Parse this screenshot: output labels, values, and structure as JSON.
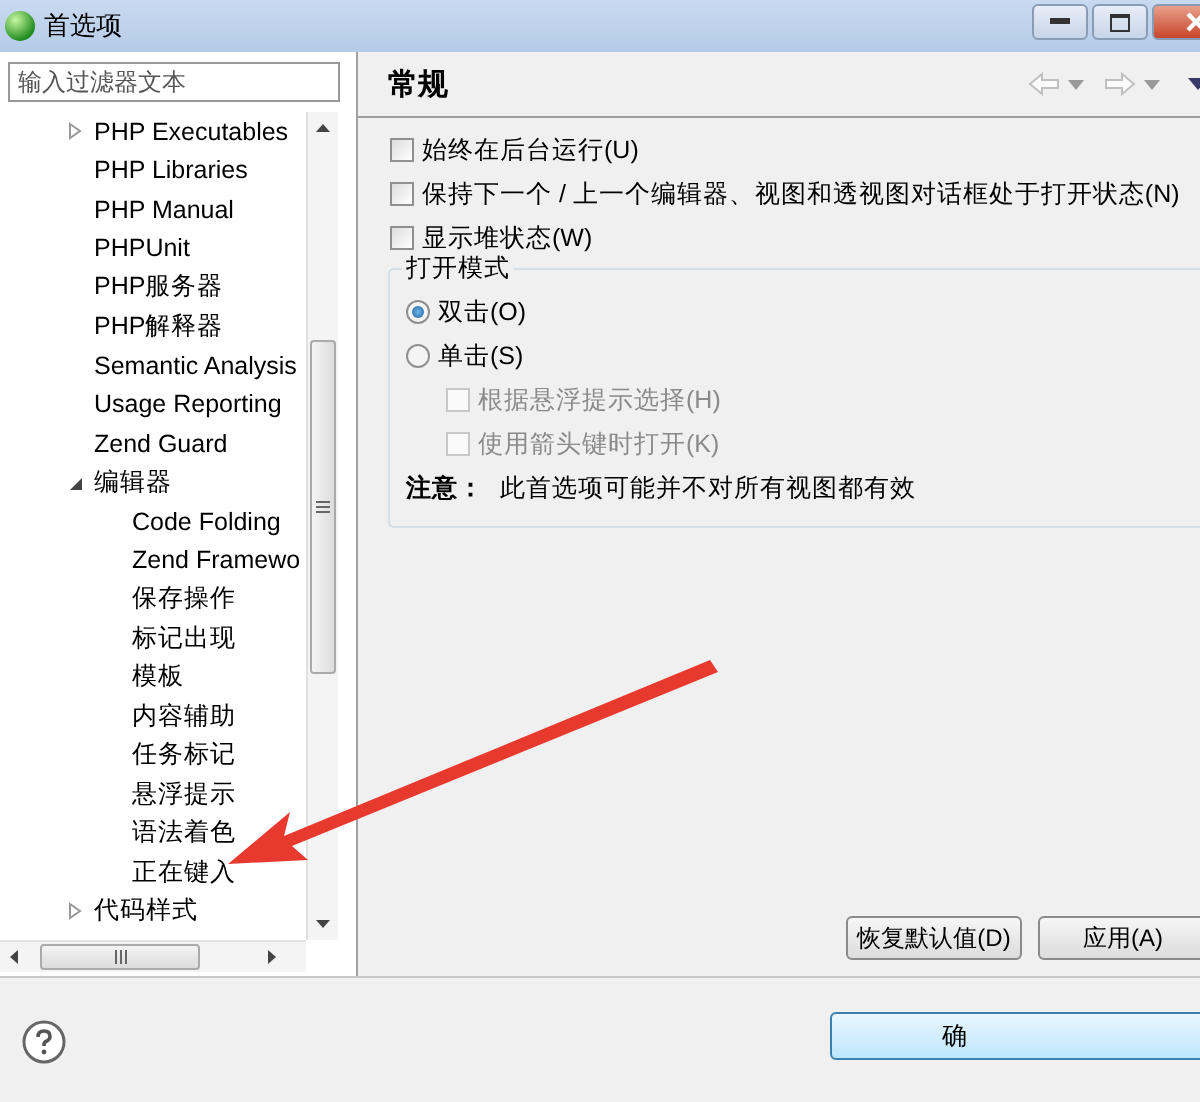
{
  "window": {
    "title": "首选项"
  },
  "filter": {
    "placeholder": "输入过滤器文本"
  },
  "tree": [
    {
      "label": "PHP Executables",
      "expanded": false
    },
    {
      "label": "PHP Libraries"
    },
    {
      "label": "PHP Manual"
    },
    {
      "label": "PHPUnit"
    },
    {
      "label": "PHP服务器"
    },
    {
      "label": "PHP解释器"
    },
    {
      "label": "Semantic Analysis"
    },
    {
      "label": "Usage Reporting"
    },
    {
      "label": "Zend Guard"
    },
    {
      "label": "编辑器",
      "expanded": true,
      "children": [
        {
          "label": "Code Folding"
        },
        {
          "label": "Zend Framewo"
        },
        {
          "label": "保存操作"
        },
        {
          "label": "标记出现"
        },
        {
          "label": "模板"
        },
        {
          "label": "内容辅助"
        },
        {
          "label": "任务标记"
        },
        {
          "label": "悬浮提示"
        },
        {
          "label": "语法着色"
        },
        {
          "label": "正在键入"
        }
      ]
    },
    {
      "label": "代码样式",
      "expanded": false
    }
  ],
  "page": {
    "title": "常规",
    "options": [
      {
        "label": "始终在后台运行(U)",
        "checked": false
      },
      {
        "label": "保持下一个 / 上一个编辑器、视图和透视图对话框处于打开状态(N)",
        "checked": false
      },
      {
        "label": "显示堆状态(W)",
        "checked": false
      }
    ],
    "group": {
      "title": "打开模式",
      "radios": [
        {
          "label": "双击(O)",
          "selected": true
        },
        {
          "label": "单击(S)",
          "selected": false
        }
      ],
      "sub_options": [
        {
          "label": "根据悬浮提示选择(H)",
          "checked": false,
          "disabled": true
        },
        {
          "label": "使用箭头键时打开(K)",
          "checked": false,
          "disabled": true
        }
      ],
      "note": {
        "label": "注意：",
        "text": "此首选项可能并不对所有视图都有效"
      }
    },
    "buttons": [
      "恢复默认值(D)",
      "应用(A)"
    ]
  },
  "footer": {
    "buttons": [
      "确"
    ]
  }
}
